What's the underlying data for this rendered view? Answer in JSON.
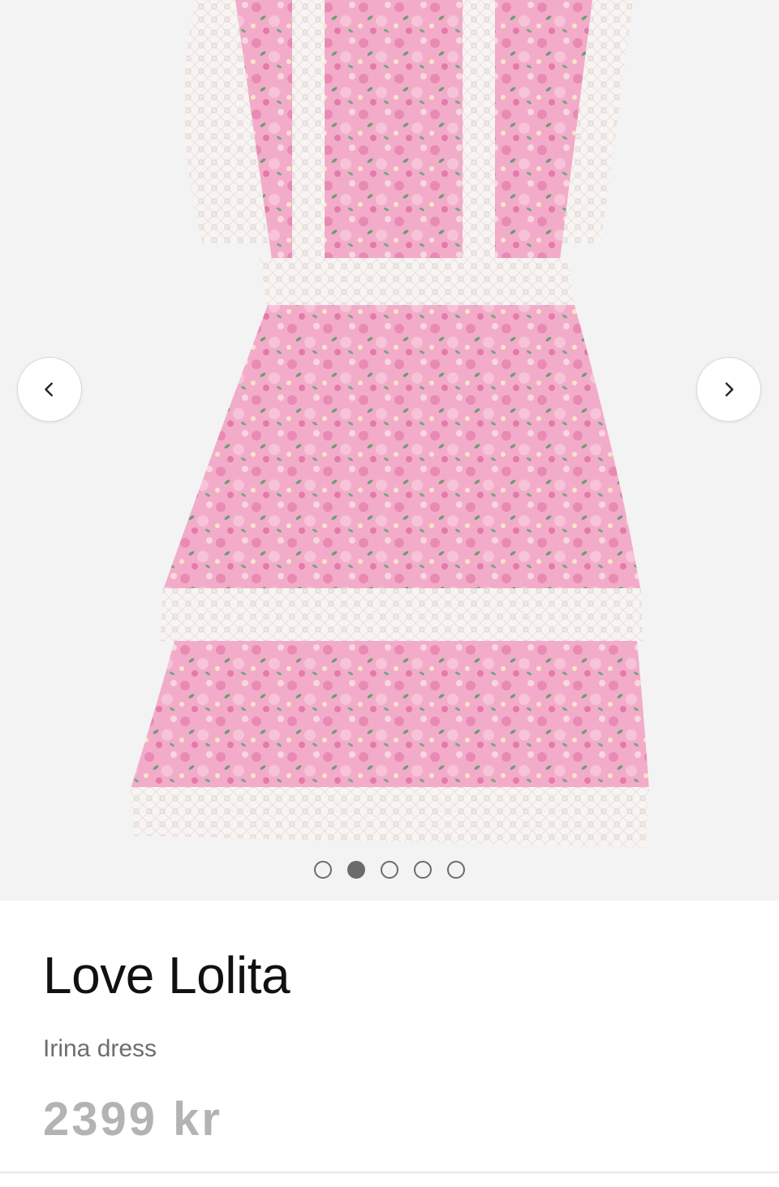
{
  "gallery": {
    "image_alt": "Pink floral tiered dress with white lace trim",
    "prev_icon": "chevron-left-icon",
    "next_icon": "chevron-right-icon",
    "dots_total": 5,
    "active_dot_index": 1
  },
  "product": {
    "brand": "Love Lolita",
    "name": "Irina dress",
    "price": "2399 kr"
  },
  "colors": {
    "gallery_bg": "#f3f3f3",
    "dress_pink": "#f1a9c8",
    "lace_white": "#f7f3f1",
    "price_text": "#b3b3b3"
  }
}
